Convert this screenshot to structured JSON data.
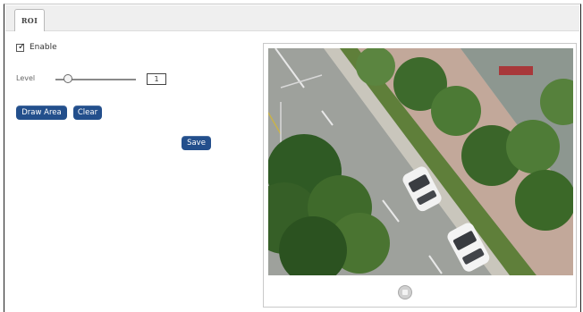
{
  "tabs": [
    {
      "label": "ROI",
      "active": true
    }
  ],
  "settings": {
    "enable_label": "Enable",
    "enable_checked": true,
    "level_label": "Level",
    "level_value": "1",
    "level_slider_fraction": 0.15
  },
  "buttons": {
    "draw_area": "Draw Area",
    "clear": "Clear",
    "save": "Save"
  },
  "preview": {
    "stop_icon": "stop-icon"
  },
  "colors": {
    "button_bg": "#234f8c",
    "button_text": "#ffffff"
  }
}
